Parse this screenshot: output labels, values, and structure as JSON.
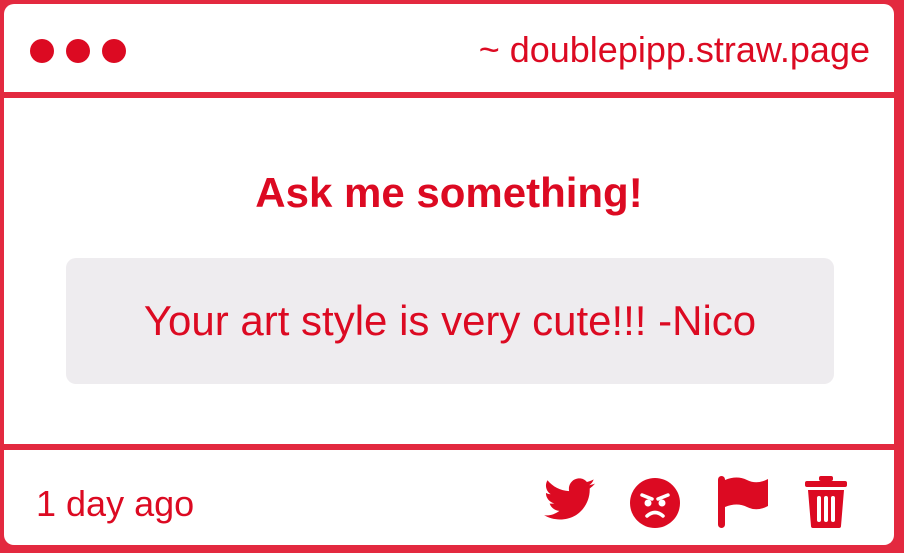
{
  "header": {
    "site": "~ doublepipp.straw.page"
  },
  "main": {
    "title": "Ask me something!",
    "message": "Your art style is very cute!!! -Nico"
  },
  "footer": {
    "time": "1 day ago",
    "actions": [
      {
        "icon": "twitter-icon"
      },
      {
        "icon": "angry-face-icon"
      },
      {
        "icon": "flag-icon"
      },
      {
        "icon": "trash-icon"
      }
    ]
  },
  "colors": {
    "accent": "#dc0a22",
    "frame": "#e3293f",
    "message_bg": "#eeecef"
  }
}
